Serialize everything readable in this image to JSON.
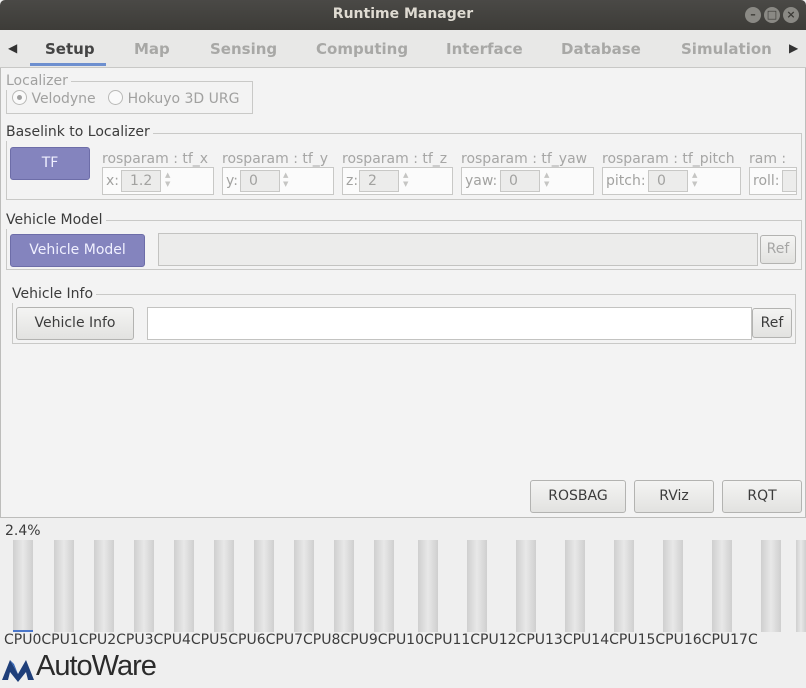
{
  "window": {
    "title": "Runtime Manager"
  },
  "tabs": [
    {
      "label": "Setup"
    },
    {
      "label": "Map"
    },
    {
      "label": "Sensing"
    },
    {
      "label": "Computing"
    },
    {
      "label": "Interface"
    },
    {
      "label": "Database"
    },
    {
      "label": "Simulation"
    }
  ],
  "localizer": {
    "title": "Localizer",
    "options": [
      {
        "label": "Velodyne",
        "selected": true
      },
      {
        "label": "Hokuyo 3D URG",
        "selected": false
      }
    ]
  },
  "baselink": {
    "title": "Baselink to Localizer",
    "tf_button": "TF",
    "params": [
      {
        "label": "rosparam : tf_x",
        "prefix": "x:",
        "value": "1.2"
      },
      {
        "label": "rosparam : tf_y",
        "prefix": "y:",
        "value": "0"
      },
      {
        "label": "rosparam : tf_z",
        "prefix": "z:",
        "value": "2"
      },
      {
        "label": "rosparam : tf_yaw",
        "prefix": "yaw:",
        "value": "0"
      },
      {
        "label": "rosparam : tf_pitch",
        "prefix": "pitch:",
        "value": "0"
      },
      {
        "label": "ram : ",
        "prefix": "roll:",
        "value": ""
      }
    ]
  },
  "vehicle_model": {
    "title": "Vehicle Model",
    "button": "Vehicle Model",
    "path": "",
    "ref": "Ref"
  },
  "vehicle_info": {
    "title": "Vehicle Info",
    "button": "Vehicle Info",
    "path": "",
    "ref": "Ref"
  },
  "tools": {
    "rosbag": "ROSBAG",
    "rviz": "RViz",
    "rqt": "RQT"
  },
  "cpu": {
    "usage_text": "2.4%",
    "usage_fraction": 0.024,
    "labels": "CPU0CPU1CPU2CPU3CPU4CPU5CPU6CPU7CPU8CPU9CPU10CPU11CPU12CPU13CPU14CPU15CPU16CPU17C"
  },
  "logo": {
    "text": "AutoWare"
  },
  "icons": {
    "tab_left": "chevron-left-icon",
    "tab_right": "chevron-right-icon",
    "minimize": "minimize-icon",
    "maximize": "maximize-icon",
    "close": "close-icon"
  },
  "colors": {
    "accent": "#6d8fcf",
    "active_button": "#8484be",
    "cpu_fill": "#4a76c9"
  }
}
